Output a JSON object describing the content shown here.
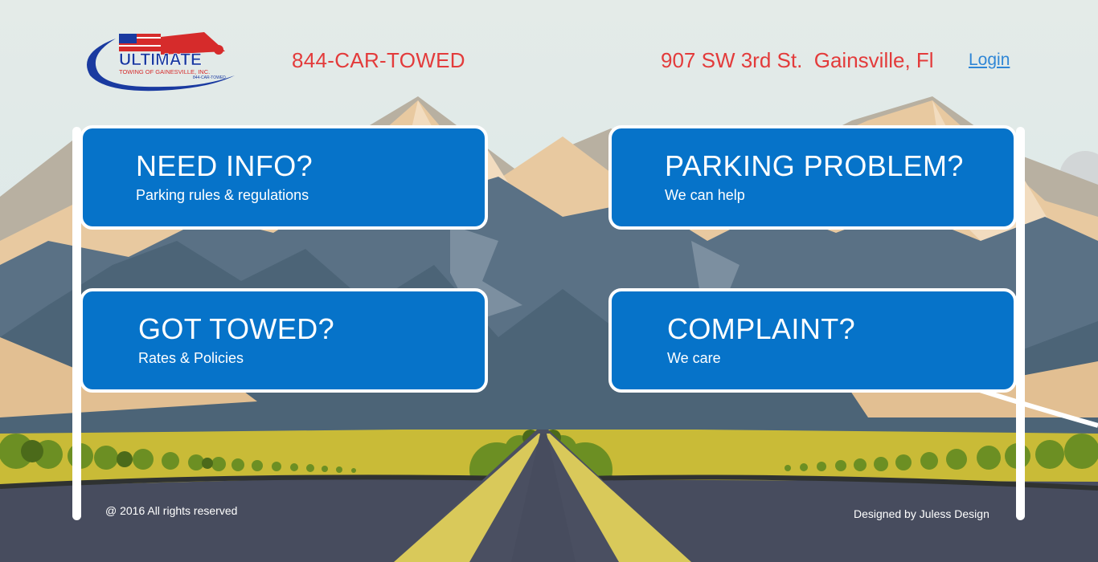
{
  "header": {
    "logo": {
      "name": "ULTIMATE",
      "tagline": "TOWING OF GAINESVILLE, INC.",
      "phone": "844-CAR-TOWED"
    },
    "phone": "844-CAR-TOWED",
    "address": "907 SW 3rd St.  Gainsville, Fl",
    "login_label": "Login"
  },
  "signs": [
    {
      "title": "NEED INFO?",
      "subtitle": "Parking rules & regulations"
    },
    {
      "title": "PARKING PROBLEM?",
      "subtitle": "We can help"
    },
    {
      "title": "GOT TOWED?",
      "subtitle": "Rates & Policies"
    },
    {
      "title": "COMPLAINT?",
      "subtitle": "We care"
    }
  ],
  "footer": {
    "copyright": "@ 2016 All rights reserved",
    "designer": "Designed by Juless Design"
  },
  "colors": {
    "accent_red": "#e33b3b",
    "sign_blue": "#0673c9",
    "link_blue": "#2f86d6"
  }
}
